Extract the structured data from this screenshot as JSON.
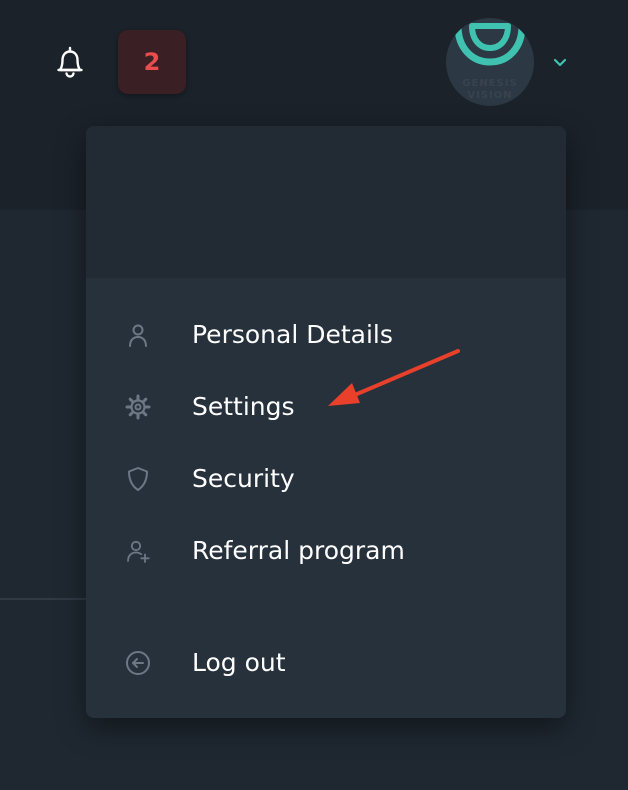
{
  "header": {
    "notifications_count": "2",
    "avatar": {
      "line1": "GENESIS",
      "line2": "VISION"
    }
  },
  "menu": {
    "items": [
      {
        "label": "Personal Details",
        "icon": "person-icon"
      },
      {
        "label": "Settings",
        "icon": "gear-icon"
      },
      {
        "label": "Security",
        "icon": "shield-icon"
      },
      {
        "label": "Referral program",
        "icon": "add-user-icon"
      }
    ],
    "logout_label": "Log out"
  },
  "colors": {
    "badge_text": "#eb4d4f",
    "badge_bg": "#3a1f24",
    "accent": "#3fc3b0",
    "menu_bg": "#27313c",
    "annotation_arrow": "#e8402a"
  }
}
